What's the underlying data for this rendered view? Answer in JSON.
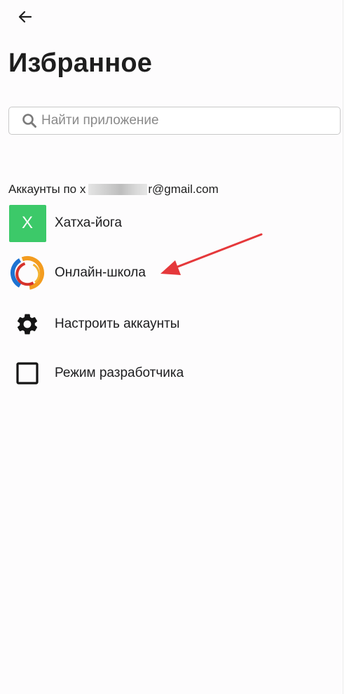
{
  "header": {
    "back_icon": "arrow-left-icon",
    "title": "Избранное"
  },
  "search": {
    "icon": "search-icon",
    "placeholder": "Найти приложение",
    "value": ""
  },
  "accounts_section": {
    "prefix": "Аккаунты по",
    "visible_partial_char": "х",
    "redacted": true,
    "suffix": "r@gmail.com"
  },
  "apps": [
    {
      "label": "Хатха-йога",
      "icon": "letter-x-avatar",
      "avatar_letter": "X",
      "avatar_color": "#3cc969"
    },
    {
      "label": "Онлайн-школа",
      "icon": "ring-logo-icon"
    }
  ],
  "actions": [
    {
      "label": "Настроить аккаунты",
      "icon": "gear-icon"
    },
    {
      "label": "Режим разработчика",
      "icon": "checkbox-icon",
      "checked": false
    }
  ],
  "colors": {
    "accent_green": "#3cc969",
    "annotation_arrow": "#e5383b",
    "ring_orange": "#f39c1f",
    "ring_blue": "#1e73d2",
    "ring_red": "#d6322b"
  }
}
